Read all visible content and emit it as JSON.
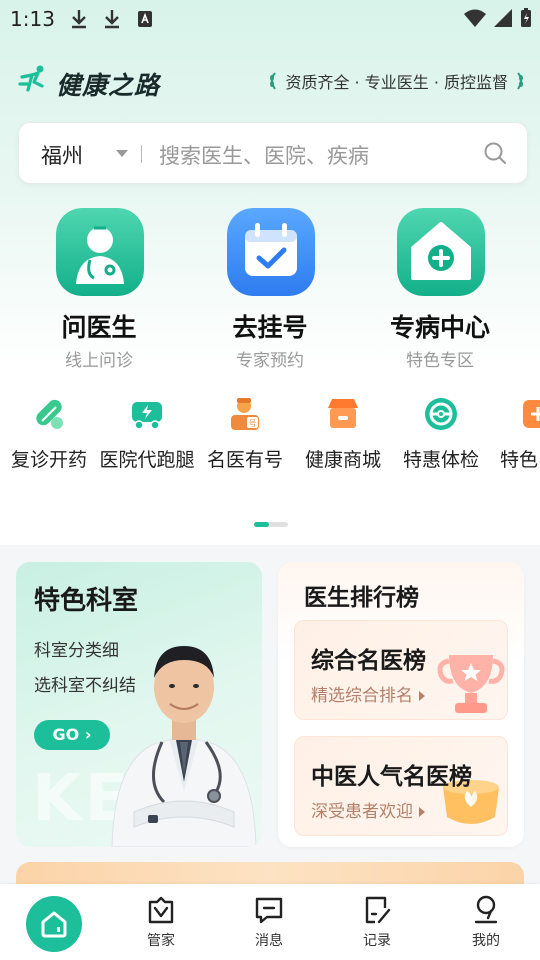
{
  "status_bar": {
    "time": "1:13"
  },
  "header": {
    "brand": "健康之路",
    "slogan": "资质齐全 · 专业医生 · 质控监督"
  },
  "search": {
    "city": "福州",
    "placeholder": "搜索医生、医院、疾病"
  },
  "main_services": [
    {
      "title": "问医生",
      "subtitle": "线上问诊",
      "icon": "doctor-icon"
    },
    {
      "title": "去挂号",
      "subtitle": "专家预约",
      "icon": "calendar-check-icon"
    },
    {
      "title": "专病中心",
      "subtitle": "特色专区",
      "icon": "hospital-plus-icon"
    }
  ],
  "secondary_services": [
    {
      "label": "复诊开药",
      "icon": "pill-icon"
    },
    {
      "label": "医院代跑腿",
      "icon": "delivery-icon"
    },
    {
      "label": "名医有号",
      "icon": "doctor-ticket-icon"
    },
    {
      "label": "健康商城",
      "icon": "shop-icon"
    },
    {
      "label": "特惠体检",
      "icon": "checkup-icon"
    },
    {
      "label": "特色",
      "icon": "special-icon"
    }
  ],
  "featured_dept": {
    "title": "特色科室",
    "line1": "科室分类细",
    "line2": "选科室不纠结",
    "go_label": "GO",
    "watermark": "KE"
  },
  "doctor_ranking": {
    "title": "医生排行榜",
    "items": [
      {
        "title": "综合名医榜",
        "subtitle": "精选综合排名"
      },
      {
        "title": "中医人气名医榜",
        "subtitle": "深受患者欢迎"
      }
    ]
  },
  "bottom_nav": [
    {
      "label": "首页",
      "icon": "home-icon",
      "active": true
    },
    {
      "label": "管家",
      "icon": "butler-icon"
    },
    {
      "label": "消息",
      "icon": "message-icon"
    },
    {
      "label": "记录",
      "icon": "record-icon"
    },
    {
      "label": "我的",
      "icon": "profile-icon"
    }
  ],
  "colors": {
    "primary": "#1cbf99",
    "accent_orange": "#ff8a3d",
    "accent_blue": "#3a8cf5"
  }
}
